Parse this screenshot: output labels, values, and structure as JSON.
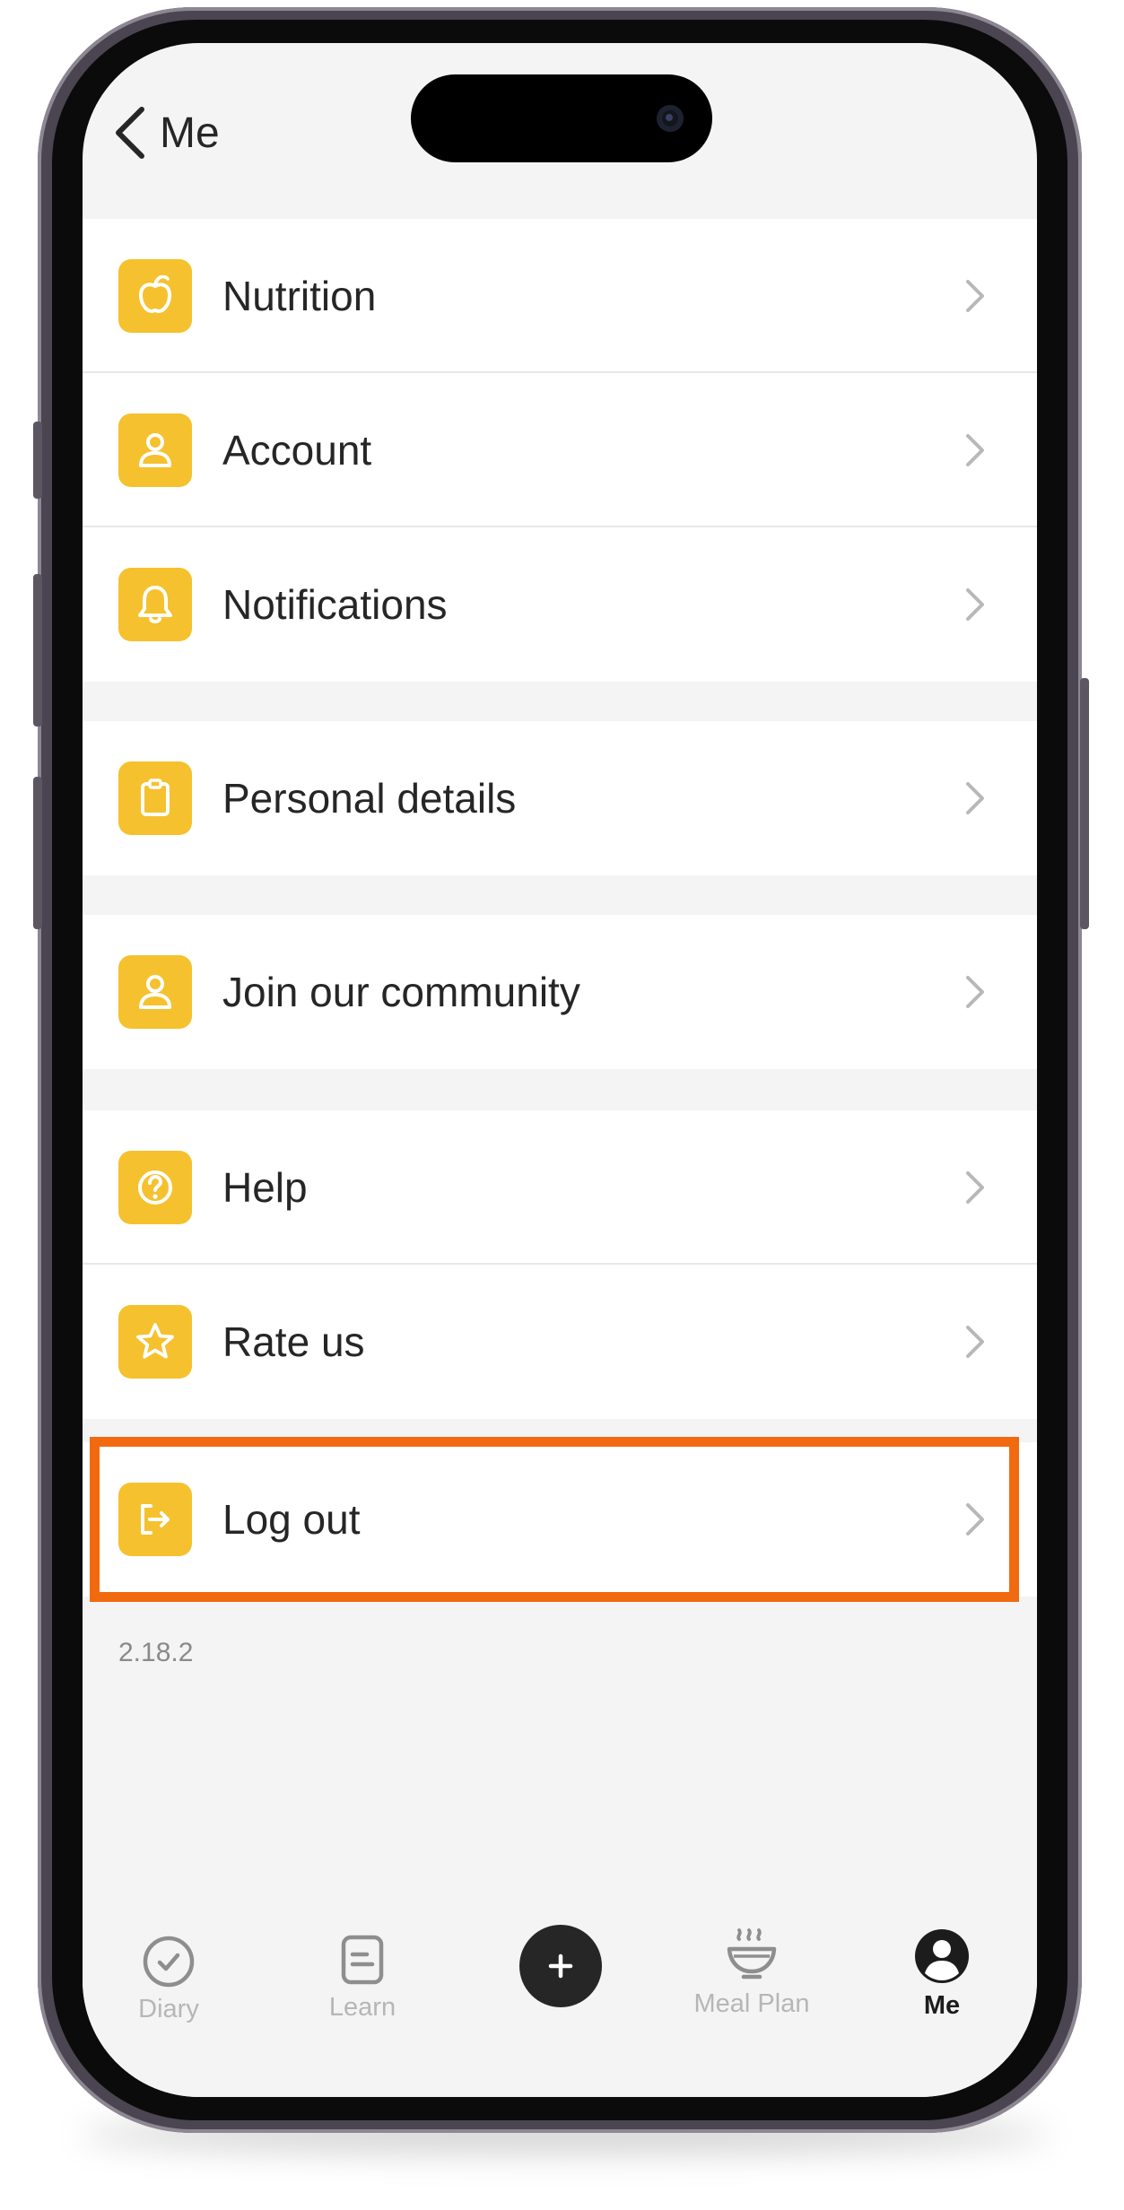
{
  "header": {
    "back_label": "Me"
  },
  "menu_groups": [
    {
      "items": [
        {
          "label": "Nutrition",
          "icon": "apple-icon"
        },
        {
          "label": "Account",
          "icon": "person-icon"
        },
        {
          "label": "Notifications",
          "icon": "bell-icon"
        }
      ]
    },
    {
      "items": [
        {
          "label": "Personal details",
          "icon": "clipboard-icon"
        }
      ]
    },
    {
      "items": [
        {
          "label": "Join our community",
          "icon": "person-icon"
        }
      ]
    },
    {
      "items": [
        {
          "label": "Help",
          "icon": "help-circle-icon"
        },
        {
          "label": "Rate us",
          "icon": "star-icon"
        }
      ]
    },
    {
      "items": [
        {
          "label": "Log out",
          "icon": "logout-icon",
          "highlighted": true
        }
      ]
    }
  ],
  "version": "2.18.2",
  "tabbar": {
    "tabs": [
      {
        "label": "Diary",
        "icon": "check-circle-icon",
        "active": false
      },
      {
        "label": "Learn",
        "icon": "document-icon",
        "active": false
      },
      {
        "label": "Meal Plan",
        "icon": "steaming-bowl-icon",
        "active": false
      },
      {
        "label": "Me",
        "icon": "user-avatar-icon",
        "active": true
      }
    ],
    "add_icon": "plus-icon"
  },
  "colors": {
    "icon_background": "#f5c12e",
    "highlight_border": "#f26a10",
    "screen_background": "#f4f4f4",
    "row_background": "#ffffff"
  }
}
